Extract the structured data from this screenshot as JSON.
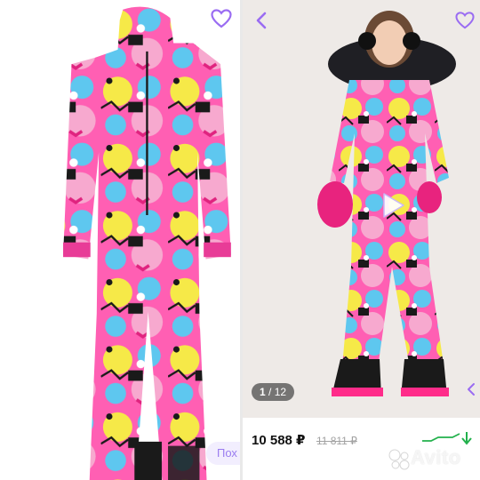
{
  "left_card": {
    "similar_label": "Пох",
    "favorite_icon": "heart-outline-icon",
    "image_desc": "ski-jumpsuit-product-photo"
  },
  "right_card": {
    "back_icon": "chevron-left-icon",
    "favorite_icon": "heart-outline-icon",
    "play_icon": "play-icon",
    "photo_counter": {
      "current": "1",
      "total": "/ 12"
    },
    "price": "10 588 ₽",
    "old_price": "11 811 ₽",
    "trend_icon": "price-trend-chart-icon"
  },
  "watermark": {
    "brand": "Avito"
  },
  "colors": {
    "accent_purple": "#9a6cf2",
    "pill_bg": "#f2eefe",
    "trend_green": "#22b14c",
    "photo_bg": "#eeeae7"
  }
}
